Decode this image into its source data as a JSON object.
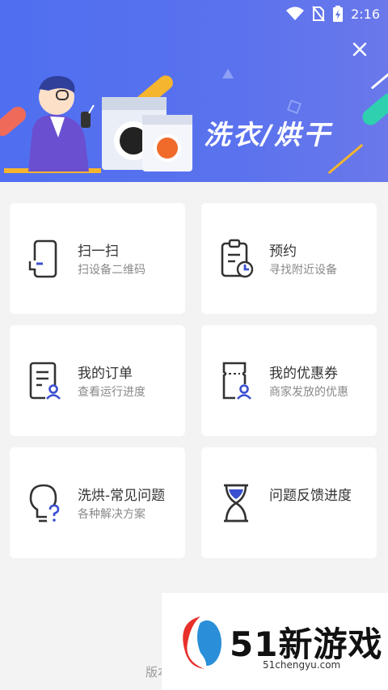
{
  "status_bar": {
    "time": "2:16"
  },
  "banner": {
    "title": "洗衣/烘干"
  },
  "cards": [
    {
      "title": "扫一扫",
      "subtitle": "扫设备二维码",
      "icon": "scan-phone-icon"
    },
    {
      "title": "预约",
      "subtitle": "寻找附近设备",
      "icon": "clipboard-clock-icon"
    },
    {
      "title": "我的订单",
      "subtitle": "查看运行进度",
      "icon": "order-user-icon"
    },
    {
      "title": "我的优惠券",
      "subtitle": "商家发放的优惠",
      "icon": "coupon-user-icon"
    },
    {
      "title": "洗烘-常见问题",
      "subtitle": "各种解决方案",
      "icon": "lightbulb-question-icon"
    },
    {
      "title": "问题反馈进度",
      "subtitle": "",
      "icon": "hourglass-icon"
    }
  ],
  "footer": {
    "text": "版本"
  },
  "watermark": {
    "brand": "51新游戏",
    "url": "51chengyu.com"
  },
  "colors": {
    "accent": "#4f6ff0",
    "icon_accent": "#3a4fd0",
    "icon_dark": "#333333"
  }
}
